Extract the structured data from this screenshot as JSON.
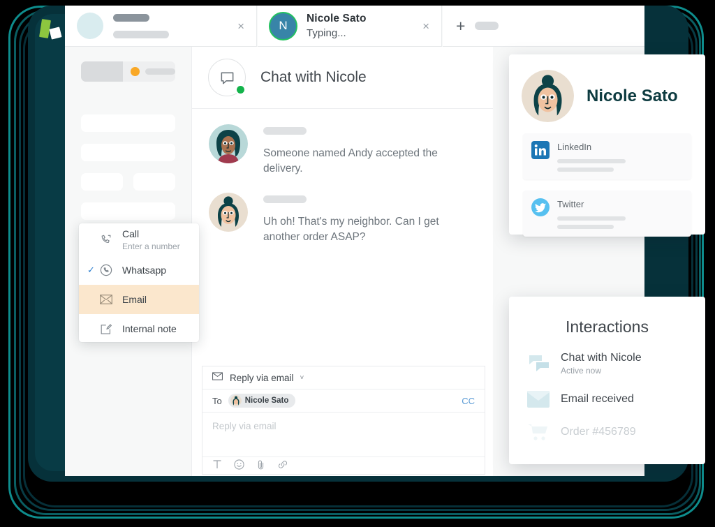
{
  "brand": {
    "logo_name": "app-logo",
    "accent_green": "#8dc63f",
    "frame_teal": "#0a5f63",
    "dark_teal": "#083b45"
  },
  "tabs": [
    {
      "name": "placeholder-tab",
      "title": "",
      "subtitle": "",
      "close_label": "×"
    },
    {
      "name": "nicole-tab",
      "title": "Nicole Sato",
      "subtitle": "Typing...",
      "avatar_initial": "N",
      "close_label": "×",
      "status_color": "#23c160"
    }
  ],
  "new_tab": {
    "plus_label": "+"
  },
  "sidebar": {
    "segment_dot_color": "#f9a826"
  },
  "conversation": {
    "header_title": "Chat with Nicole",
    "status_color": "#13b34b",
    "messages": [
      {
        "sender": "agent",
        "text": "Someone named Andy accepted the delivery."
      },
      {
        "sender": "nicole",
        "text": "Uh oh! That's my neighbor. Can I get another order ASAP?"
      }
    ]
  },
  "composer": {
    "channel_label": "Reply via email",
    "chevron": "˅",
    "to_label": "To",
    "recipient": "Nicole Sato",
    "cc_label": "CC",
    "placeholder": "Reply via email",
    "tools": [
      {
        "name": "text-format-icon",
        "glyph": "T"
      },
      {
        "name": "emoji-icon",
        "glyph": "☺"
      },
      {
        "name": "attachment-icon",
        "glyph": "📎"
      },
      {
        "name": "link-icon",
        "glyph": "⚭"
      }
    ]
  },
  "channel_menu": {
    "items": [
      {
        "label": "Call",
        "sublabel": "Enter a number",
        "icon": "phone-icon",
        "selected": false,
        "highlighted": false
      },
      {
        "label": "Whatsapp",
        "sublabel": "",
        "icon": "whatsapp-icon",
        "selected": true,
        "highlighted": false
      },
      {
        "label": "Email",
        "sublabel": "",
        "icon": "envelope-icon",
        "selected": false,
        "highlighted": true
      },
      {
        "label": "Internal note",
        "sublabel": "",
        "icon": "note-edit-icon",
        "selected": false,
        "highlighted": false
      }
    ],
    "check_glyph": "✓",
    "highlight_color": "#fbe7cd",
    "check_color": "#2f80d0"
  },
  "contact_card": {
    "name": "Nicole Sato",
    "name_color": "#0d3b40",
    "socials": [
      {
        "name": "LinkedIn",
        "icon": "linkedin-icon",
        "color": "#1b76b5"
      },
      {
        "name": "Twitter",
        "icon": "twitter-icon",
        "color": "#56c0f0"
      }
    ]
  },
  "interactions": {
    "title": "Interactions",
    "items": [
      {
        "label": "Chat with Nicole",
        "sublabel": "Active now",
        "icon": "chat-bubbles-icon",
        "faded": false
      },
      {
        "label": "Email received",
        "sublabel": "",
        "icon": "envelope-icon",
        "faded": false
      },
      {
        "label": "Order #456789",
        "sublabel": "",
        "icon": "cart-icon",
        "faded": true
      }
    ]
  }
}
